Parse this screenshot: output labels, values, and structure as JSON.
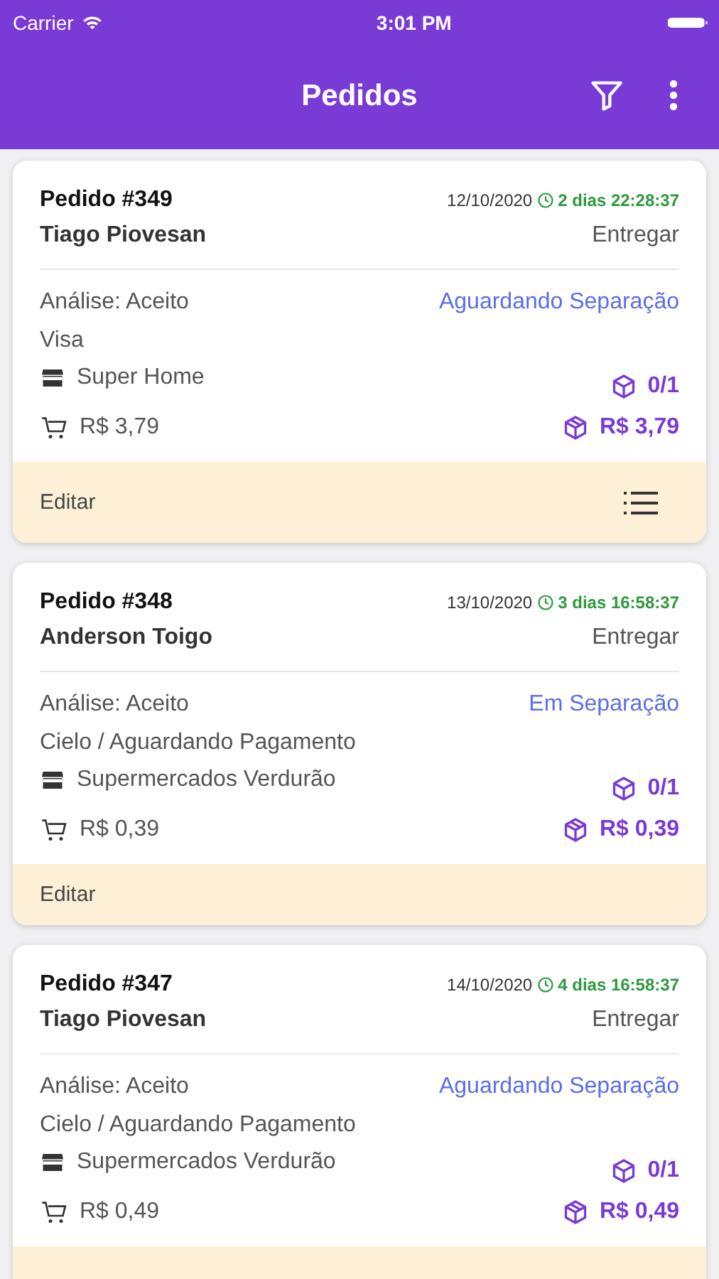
{
  "status_bar": {
    "carrier": "Carrier",
    "time": "3:01 PM"
  },
  "header": {
    "title": "Pedidos"
  },
  "orders": [
    {
      "title": "Pedido #349",
      "date": "12/10/2020",
      "timer": "2 dias 22:28:37",
      "customer": "Tiago Piovesan",
      "delivery": "Entregar",
      "analysis": "Análise: Aceito",
      "status": "Aguardando Separação",
      "payment": "Visa",
      "store": "Super Home",
      "quantity": "0/1",
      "cart_total": "R$ 3,79",
      "package_total": "R$ 3,79",
      "edit": "Editar",
      "list_button": true
    },
    {
      "title": "Pedido #348",
      "date": "13/10/2020",
      "timer": "3 dias 16:58:37",
      "customer": "Anderson Toigo",
      "delivery": "Entregar",
      "analysis": "Análise: Aceito",
      "status": "Em Separação",
      "payment": "Cielo / Aguardando Pagamento",
      "store": "Supermercados Verdurão",
      "quantity": "0/1",
      "cart_total": "R$ 0,39",
      "package_total": "R$ 0,39",
      "edit": "Editar",
      "list_button": false
    },
    {
      "title": "Pedido #347",
      "date": "14/10/2020",
      "timer": "4 dias 16:58:37",
      "customer": "Tiago Piovesan",
      "delivery": "Entregar",
      "analysis": "Análise: Aceito",
      "status": "Aguardando Separação",
      "payment": "Cielo / Aguardando Pagamento",
      "store": "Supermercados Verdurão",
      "quantity": "0/1",
      "cart_total": "R$ 0,49",
      "package_total": "R$ 0,49",
      "list_button": false
    }
  ]
}
